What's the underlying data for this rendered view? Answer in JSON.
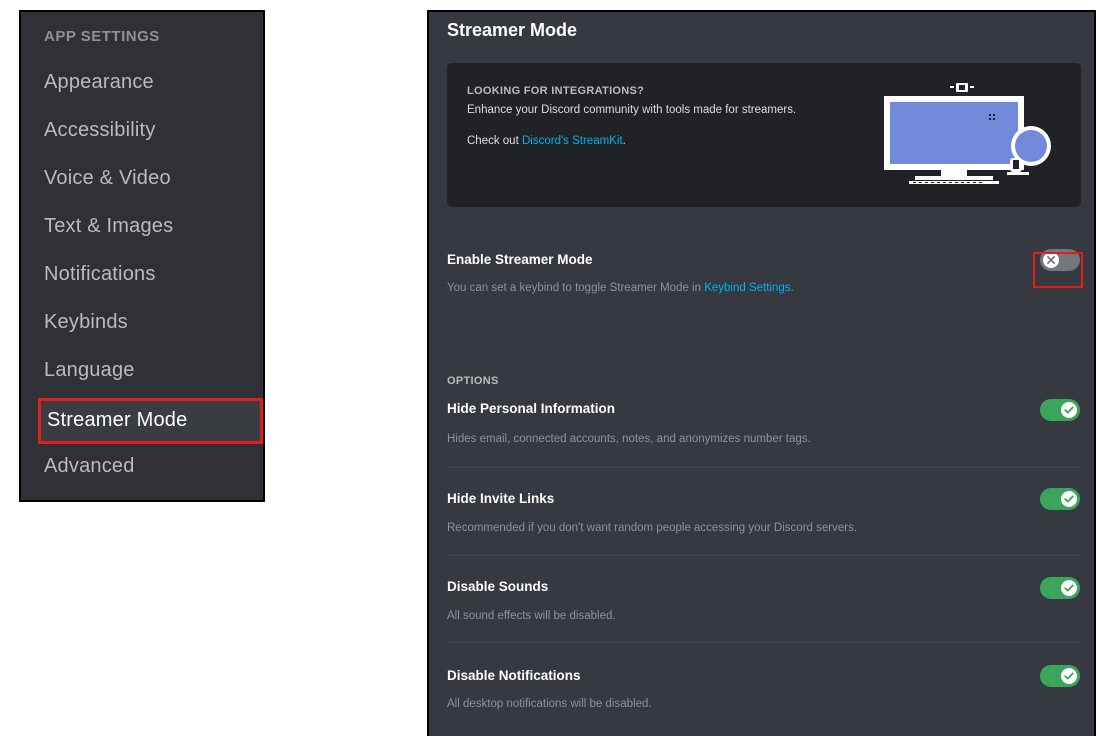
{
  "sidebar": {
    "heading": "APP SETTINGS",
    "items": [
      {
        "label": "Appearance"
      },
      {
        "label": "Accessibility"
      },
      {
        "label": "Voice & Video"
      },
      {
        "label": "Text & Images"
      },
      {
        "label": "Notifications"
      },
      {
        "label": "Keybinds"
      },
      {
        "label": "Language"
      },
      {
        "label": "Streamer Mode",
        "active": true
      },
      {
        "label": "Advanced"
      }
    ]
  },
  "main": {
    "title": "Streamer Mode",
    "promo": {
      "heading": "LOOKING FOR INTEGRATIONS?",
      "text": "Enhance your Discord community with tools made for streamers.",
      "link_prefix": "Check out ",
      "link_text": "Discord's StreamKit",
      "link_suffix": ".",
      "art_icon": "monitor-streamkit-illustration"
    },
    "enable": {
      "title": "Enable Streamer Mode",
      "desc_prefix": "You can set a keybind to toggle Streamer Mode in ",
      "desc_link": "Keybind Settings",
      "desc_suffix": ".",
      "state": "off"
    },
    "options_label": "OPTIONS",
    "options": [
      {
        "title": "Hide Personal Information",
        "desc": "Hides email, connected accounts, notes, and anonymizes number tags.",
        "state": "on"
      },
      {
        "title": "Hide Invite Links",
        "desc": "Recommended if you don't want random people accessing your Discord servers.",
        "state": "on"
      },
      {
        "title": "Disable Sounds",
        "desc": "All sound effects will be disabled.",
        "state": "on"
      },
      {
        "title": "Disable Notifications",
        "desc": "All desktop notifications will be disabled.",
        "state": "on"
      }
    ]
  },
  "colors": {
    "sidebar_bg": "#2f3136",
    "main_bg": "#36393f",
    "toggle_on": "#3ba55c",
    "toggle_off": "#72767d",
    "link": "#00b0f4",
    "highlight": "#e01e1e"
  }
}
